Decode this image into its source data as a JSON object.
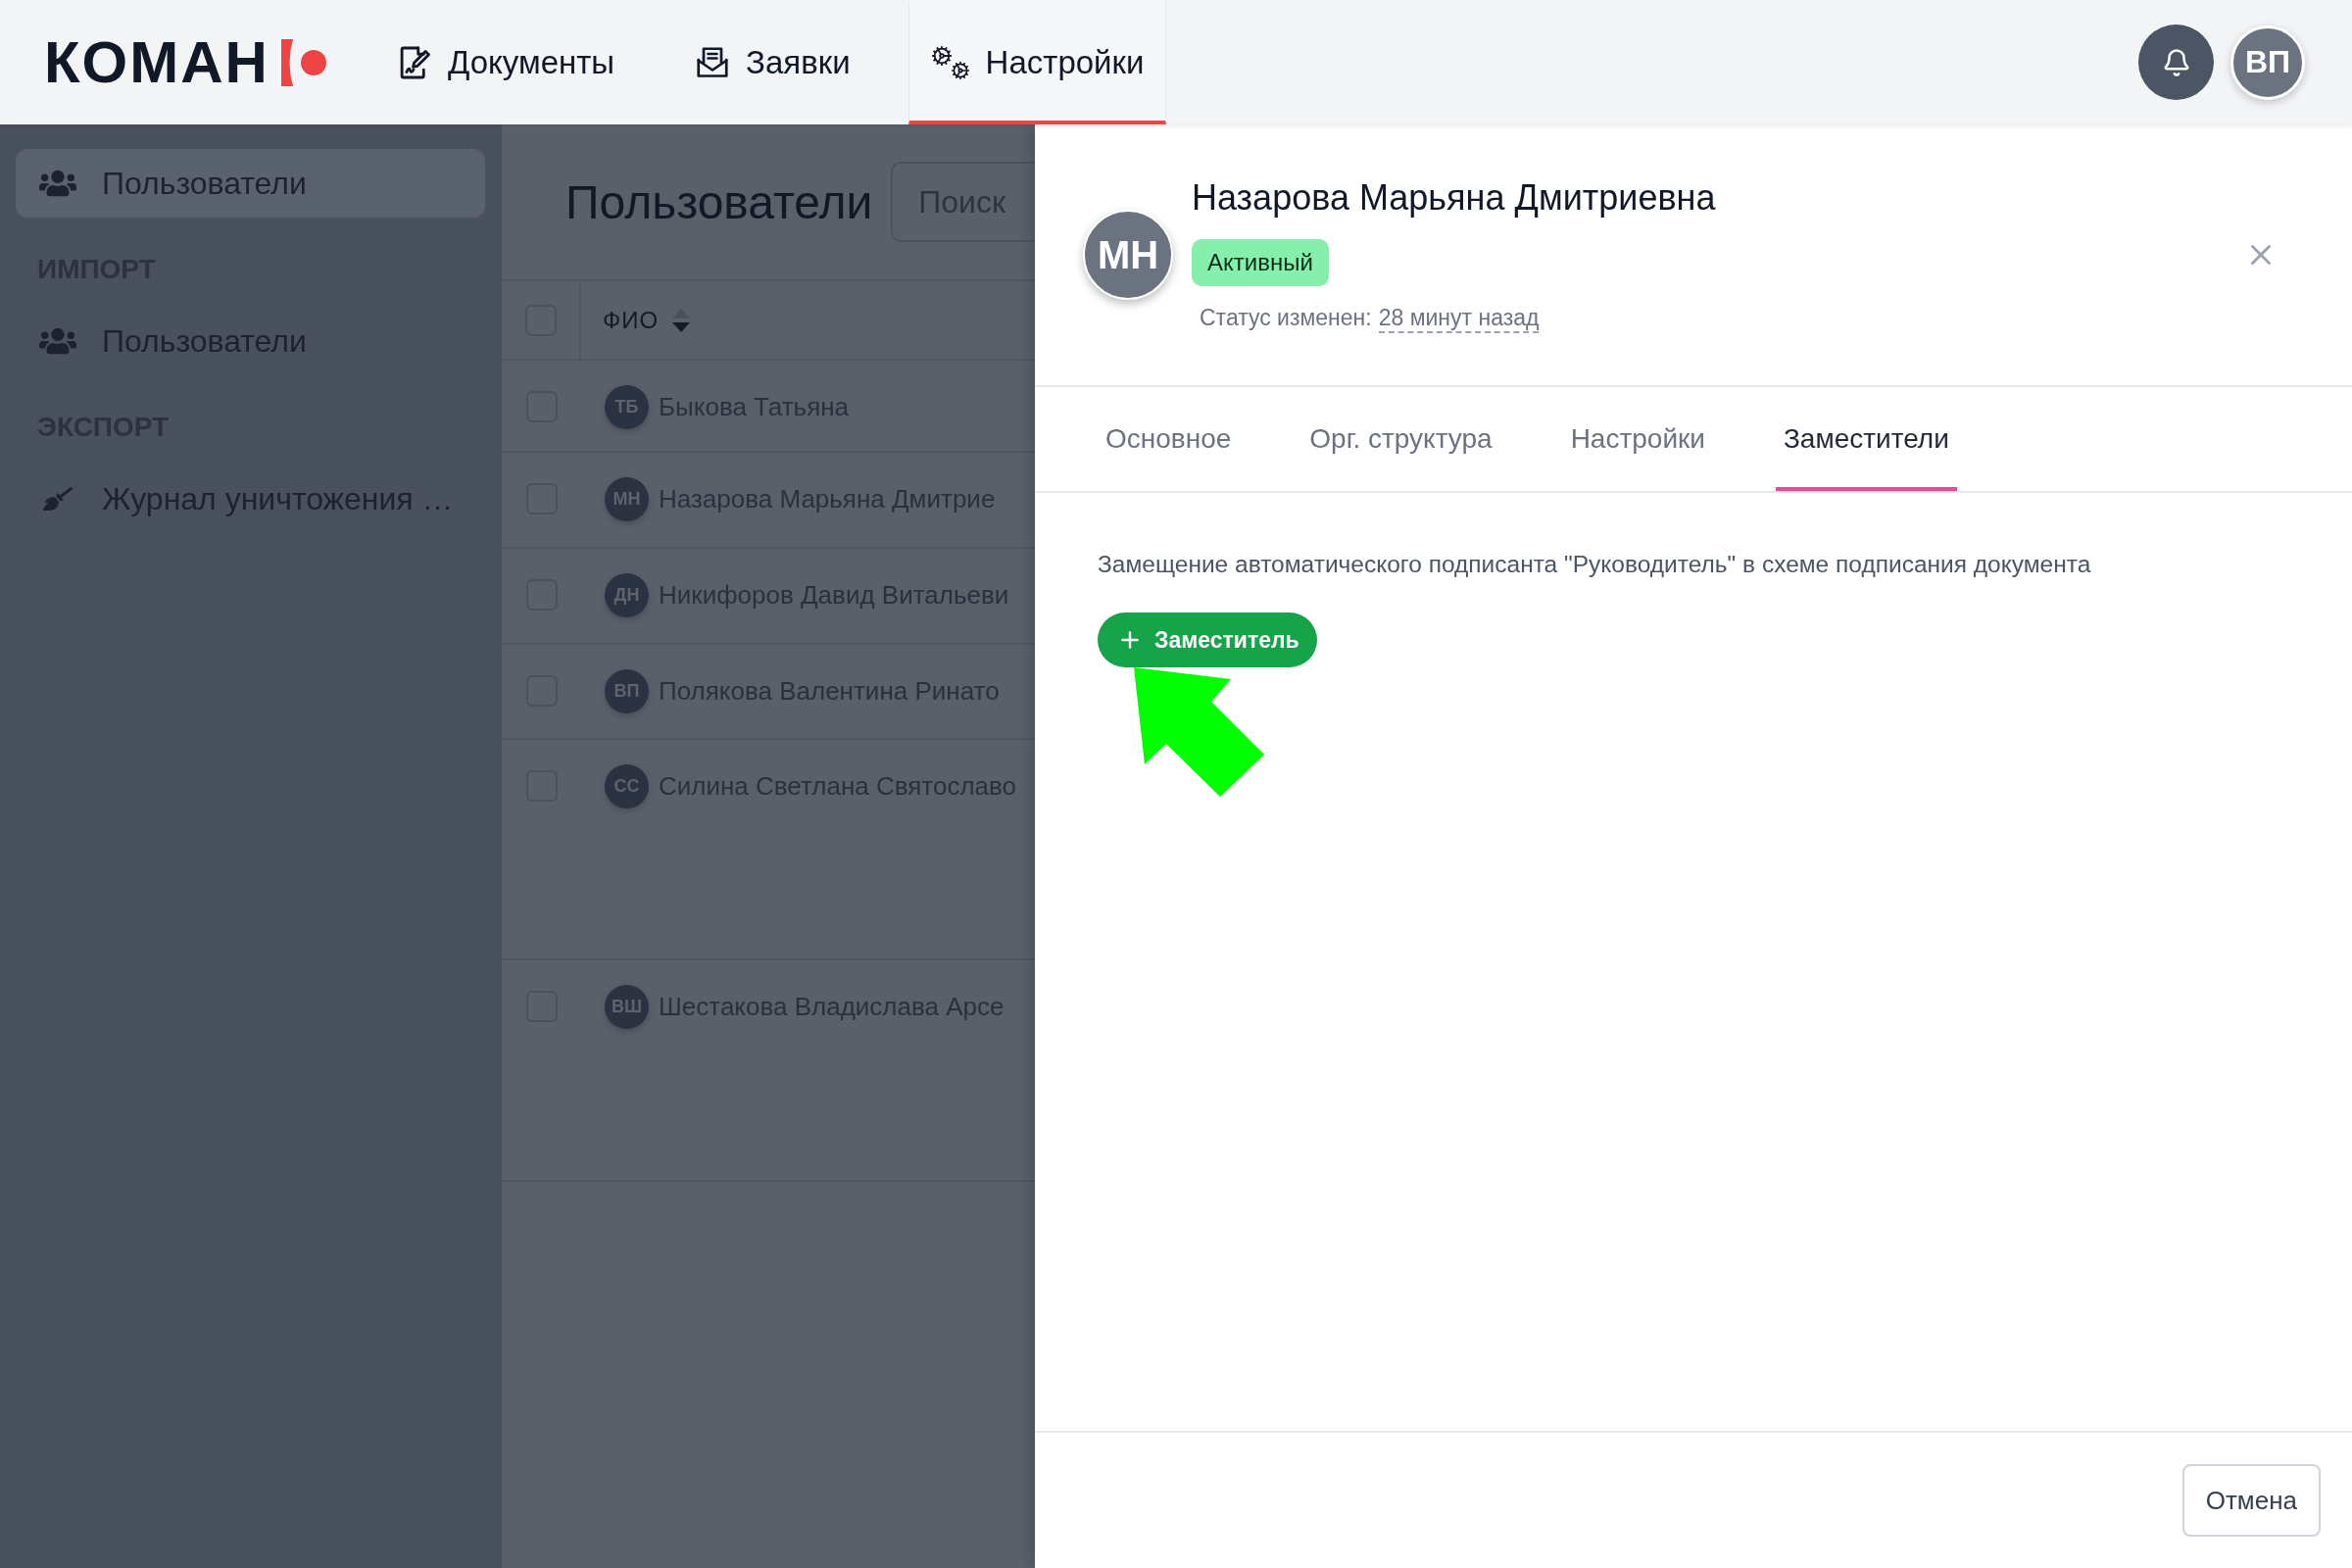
{
  "header": {
    "logo": "КОМАН",
    "nav": [
      {
        "label": "Документы",
        "selected": false
      },
      {
        "label": "Заявки",
        "selected": false
      },
      {
        "label": "Настройки",
        "selected": true
      }
    ],
    "user_avatar": "ВП"
  },
  "sidebar": {
    "sections": [
      {
        "items": [
          {
            "label": "Пользователи",
            "selected": true
          }
        ]
      },
      {
        "heading": "ИМПОРТ",
        "items": [
          {
            "label": "Пользователи",
            "selected": false
          }
        ]
      },
      {
        "heading": "ЭКСПОРТ",
        "items": [
          {
            "label": "Журнал уничтожения …",
            "selected": false
          }
        ]
      }
    ]
  },
  "main": {
    "title": "Пользователи",
    "search": {
      "placeholder": "Поиск"
    },
    "table": {
      "select_all": {
        "checked": false
      },
      "columns": [
        {
          "label": "ФИО",
          "sort_descending": true
        }
      ],
      "rows": [
        {
          "initials": "ТБ",
          "name": "Быкова Татьяна",
          "checked": false
        },
        {
          "initials": "МН",
          "name": "Назарова Марьяна Дмитрие",
          "checked": false
        },
        {
          "initials": "ДН",
          "name": "Никифоров Давид Витальеви",
          "checked": false
        },
        {
          "initials": "ВП",
          "name": "Полякова Валентина Ринато",
          "checked": false
        },
        {
          "initials": "СС",
          "name": "Силина Светлана Святославо",
          "checked": false
        },
        {
          "initials": "ВШ",
          "name": "Шестакова Владислава Арсе",
          "checked": false
        }
      ]
    }
  },
  "drawer": {
    "avatar": "МН",
    "name": "Назарова Марьяна Дмитриевна",
    "status": "Активный",
    "status_changed": {
      "label": "Статус изменен:",
      "time": "28 минут назад"
    },
    "tabs": [
      {
        "label": "Основное",
        "selected": false
      },
      {
        "label": "Орг. структура",
        "selected": false
      },
      {
        "label": "Настройки",
        "selected": false
      },
      {
        "label": "Заместители",
        "selected": true
      }
    ],
    "description": "Замещение автоматического подписанта \"Руководитель\" в схеме подписания документа",
    "add_button": "Заместитель",
    "cancel_button": "Отмена"
  }
}
